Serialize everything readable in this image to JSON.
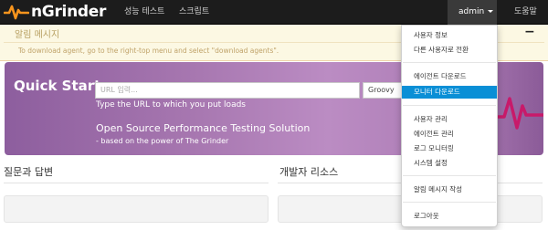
{
  "navbar": {
    "brand": "nGrinder",
    "links": [
      "성능 테스트",
      "스크립트"
    ],
    "user": "admin",
    "help": "도움말"
  },
  "alert": {
    "title": "알림 메시지",
    "close": "−",
    "text": "To download agent, go to the right-top menu and select \"download agents\"."
  },
  "quickstart": {
    "title": "Quick Start",
    "url_placeholder": "URL 입력...",
    "engine": "Groovy",
    "hint": "Type the URL to which you put loads",
    "solution_title": "Open Source Performance Testing Solution",
    "solution_sub": "- based on the power of The Grinder"
  },
  "sections": {
    "qa": "질문과 답변",
    "dev": "개발자 리소스"
  },
  "dropdown": {
    "items": [
      "사용자 정보",
      "다른 사용자로 전환",
      "에이전트 다운로드",
      "모니터 다운로드",
      "사용자 관리",
      "에이전트 관리",
      "로그 모니터링",
      "시스템 설정",
      "알림 메시지 작성",
      "로그아웃"
    ],
    "active_index": 3
  },
  "colors": {
    "navbar": "#1c1c1c",
    "accent": "#0a8fd6",
    "alert_bg": "#fcf8e3",
    "hero": "#a777b0",
    "logo_icon": "#f7941d"
  }
}
